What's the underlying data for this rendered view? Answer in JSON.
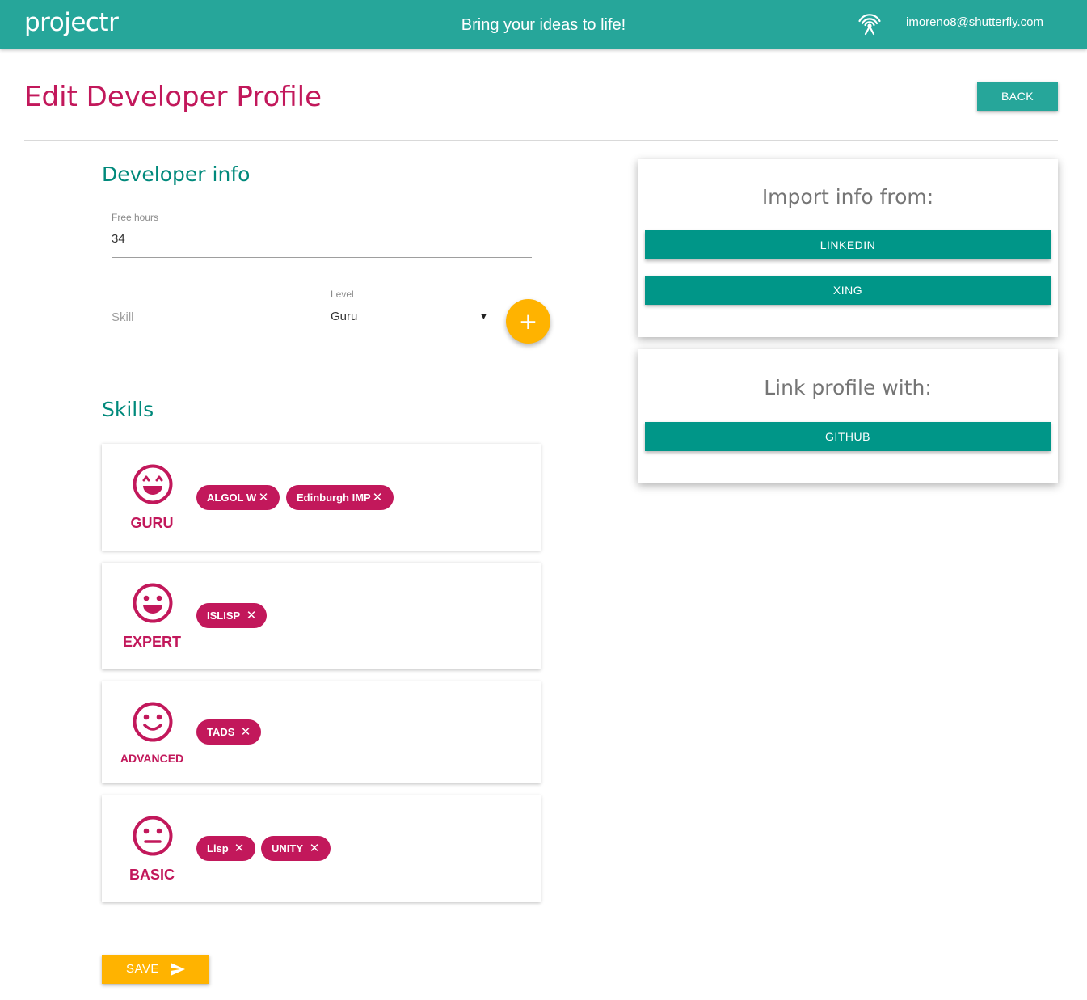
{
  "header": {
    "brand": "projectr",
    "tagline": "Bring your ideas to life!",
    "user_email": "imoreno8@shutterfly.com"
  },
  "page": {
    "title": "Edit Developer Profile",
    "back_label": "BACK"
  },
  "developer_info": {
    "title": "Developer info",
    "free_hours_label": "Free hours",
    "free_hours_value": "34",
    "skill_placeholder": "Skill",
    "level_label": "Level",
    "level_value": "Guru",
    "add_icon": "plus-icon"
  },
  "skills": {
    "title": "Skills",
    "groups": [
      {
        "level": "GURU",
        "icon": "grinning-face-icon",
        "chips": [
          "ALGOL W",
          "Edinburgh IMP"
        ]
      },
      {
        "level": "EXPERT",
        "icon": "smiling-face-icon",
        "chips": [
          "ISLISP"
        ]
      },
      {
        "level": "ADVANCED",
        "icon": "slight-smile-face-icon",
        "chips": [
          "TADS"
        ]
      },
      {
        "level": "BASIC",
        "icon": "neutral-face-icon",
        "chips": [
          "Lisp",
          "UNITY"
        ]
      }
    ]
  },
  "save_label": "SAVE",
  "import_panel": {
    "title": "Import info from:",
    "buttons": [
      "LINKEDIN",
      "XING"
    ]
  },
  "link_panel": {
    "title": "Link profile with:",
    "buttons": [
      "GITHUB"
    ]
  },
  "colors": {
    "primary": "#26a69a",
    "accent": "#c2185b",
    "amber": "#ffb300",
    "teal_dark": "#009688"
  }
}
